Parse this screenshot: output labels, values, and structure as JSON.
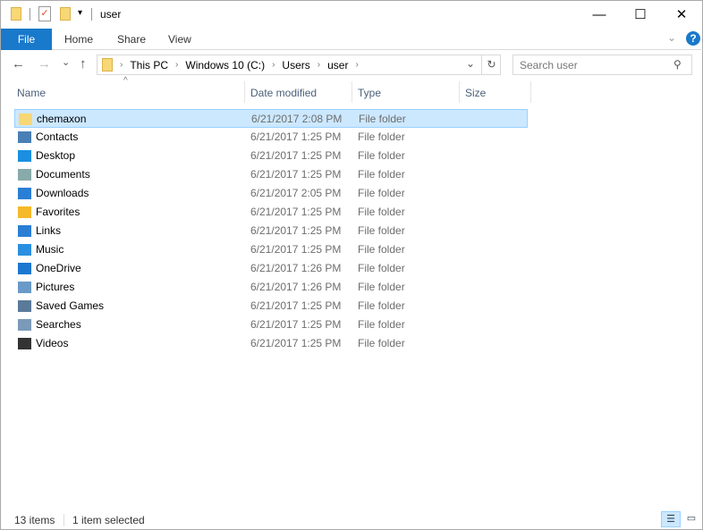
{
  "window": {
    "title": "user",
    "minimize": "—",
    "maximize": "☐",
    "close": "✕"
  },
  "ribbon": {
    "tabs": [
      "File",
      "Home",
      "Share",
      "View"
    ],
    "help": "?",
    "expand": "⌄"
  },
  "nav": {
    "back": "←",
    "forward": "→",
    "recent": "⌄",
    "up": "↑",
    "refresh": "↻",
    "dropdown": "⌄"
  },
  "address": {
    "crumbs": [
      "This PC",
      "Windows 10 (C:)",
      "Users",
      "user"
    ]
  },
  "search": {
    "placeholder": "Search user"
  },
  "columns": [
    "Name",
    "Date modified",
    "Type",
    "Size"
  ],
  "files": [
    {
      "name": "chemaxon",
      "date": "6/21/2017 2:08 PM",
      "type": "File folder",
      "icon": "folder-icon",
      "color": "#f8d775"
    },
    {
      "name": "Contacts",
      "date": "6/21/2017 1:25 PM",
      "type": "File folder",
      "icon": "contacts-icon",
      "color": "#4a7fb5"
    },
    {
      "name": "Desktop",
      "date": "6/21/2017 1:25 PM",
      "type": "File folder",
      "icon": "desktop-icon",
      "color": "#1a8fe0"
    },
    {
      "name": "Documents",
      "date": "6/21/2017 1:25 PM",
      "type": "File folder",
      "icon": "documents-icon",
      "color": "#8aa"
    },
    {
      "name": "Downloads",
      "date": "6/21/2017 2:05 PM",
      "type": "File folder",
      "icon": "downloads-icon",
      "color": "#2a7fd4"
    },
    {
      "name": "Favorites",
      "date": "6/21/2017 1:25 PM",
      "type": "File folder",
      "icon": "favorites-icon",
      "color": "#f5b92a"
    },
    {
      "name": "Links",
      "date": "6/21/2017 1:25 PM",
      "type": "File folder",
      "icon": "links-icon",
      "color": "#2a7fd4"
    },
    {
      "name": "Music",
      "date": "6/21/2017 1:25 PM",
      "type": "File folder",
      "icon": "music-icon",
      "color": "#2a8fe0"
    },
    {
      "name": "OneDrive",
      "date": "6/21/2017 1:26 PM",
      "type": "File folder",
      "icon": "onedrive-icon",
      "color": "#1a78d0"
    },
    {
      "name": "Pictures",
      "date": "6/21/2017 1:26 PM",
      "type": "File folder",
      "icon": "pictures-icon",
      "color": "#6a9ac8"
    },
    {
      "name": "Saved Games",
      "date": "6/21/2017 1:25 PM",
      "type": "File folder",
      "icon": "saved-games-icon",
      "color": "#5a7a9a"
    },
    {
      "name": "Searches",
      "date": "6/21/2017 1:25 PM",
      "type": "File folder",
      "icon": "searches-icon",
      "color": "#7a9ab8"
    },
    {
      "name": "Videos",
      "date": "6/21/2017 1:25 PM",
      "type": "File folder",
      "icon": "videos-icon",
      "color": "#333"
    }
  ],
  "status": {
    "count": "13 items",
    "selected": "1 item selected"
  }
}
